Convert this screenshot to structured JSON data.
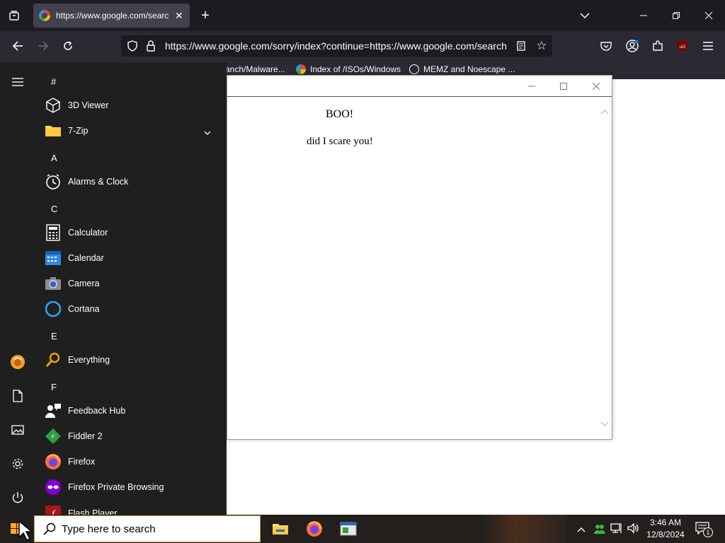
{
  "browser": {
    "tab": {
      "title": "https://www.google.com/searc",
      "favicon": "google-g-icon"
    },
    "url": "https://www.google.com/sorry/index?continue=https://www.google.com/search",
    "bookmarks": [
      {
        "label": "anch/Malware..."
      },
      {
        "label": "Index of /ISOs/Windows",
        "icon": "google-g-icon"
      },
      {
        "label": "MEMZ and Noescape ...",
        "icon": "globe-icon"
      }
    ]
  },
  "popup": {
    "heading": "BOO!",
    "message": "did I scare you!"
  },
  "start_menu": {
    "groups": [
      {
        "letter": "#",
        "apps": [
          {
            "label": "3D Viewer",
            "icon": "cube-icon"
          },
          {
            "label": "7-Zip",
            "icon": "folder-icon",
            "expandable": true
          }
        ]
      },
      {
        "letter": "A",
        "apps": [
          {
            "label": "Alarms & Clock",
            "icon": "clock-icon"
          }
        ]
      },
      {
        "letter": "C",
        "apps": [
          {
            "label": "Calculator",
            "icon": "calculator-icon"
          },
          {
            "label": "Calendar",
            "icon": "calendar-icon"
          },
          {
            "label": "Camera",
            "icon": "camera-icon"
          },
          {
            "label": "Cortana",
            "icon": "cortana-icon"
          }
        ]
      },
      {
        "letter": "E",
        "apps": [
          {
            "label": "Everything",
            "icon": "magnifier-icon"
          }
        ]
      },
      {
        "letter": "F",
        "apps": [
          {
            "label": "Feedback Hub",
            "icon": "feedback-icon"
          },
          {
            "label": "Fiddler 2",
            "icon": "fiddler-icon"
          },
          {
            "label": "Firefox",
            "icon": "firefox-icon"
          },
          {
            "label": "Firefox Private Browsing",
            "icon": "private-browsing-icon"
          },
          {
            "label": "Flash Player",
            "icon": "flash-icon"
          }
        ]
      }
    ]
  },
  "taskbar": {
    "search_placeholder": "Type here to search",
    "time": "3:46 AM",
    "date": "12/8/2024",
    "notification_count": "1"
  },
  "colors": {
    "chrome_dark": "#1c1b22",
    "toolbar": "#2b2a33",
    "start_bg": "#1f1f1f",
    "accent_blue": "#0a84ff"
  }
}
